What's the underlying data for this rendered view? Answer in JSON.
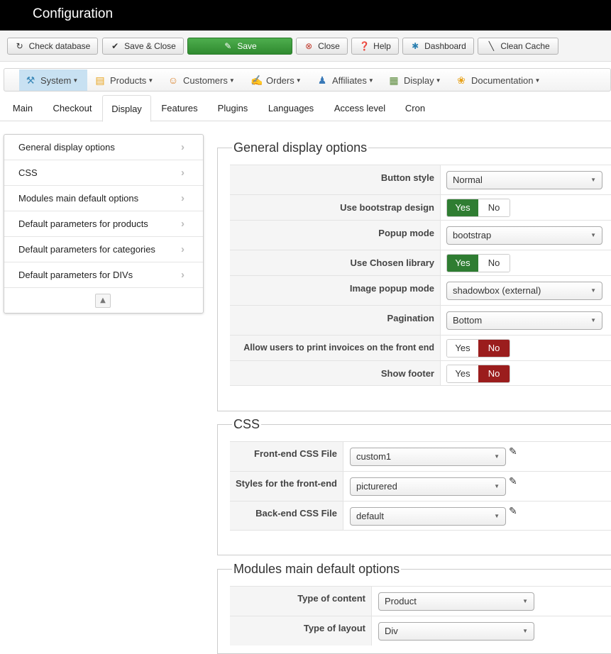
{
  "window": {
    "title": "Configuration"
  },
  "toolbar": {
    "check_database": "Check database",
    "save_close": "Save & Close",
    "save": "Save",
    "close": "Close",
    "help": "Help",
    "dashboard": "Dashboard",
    "clean_cache": "Clean Cache"
  },
  "menu": {
    "system": "System",
    "products": "Products",
    "customers": "Customers",
    "orders": "Orders",
    "affiliates": "Affiliates",
    "display": "Display",
    "documentation": "Documentation"
  },
  "tabs": {
    "main": "Main",
    "checkout": "Checkout",
    "display": "Display",
    "features": "Features",
    "plugins": "Plugins",
    "languages": "Languages",
    "access_level": "Access level",
    "cron": "Cron"
  },
  "sidenav": {
    "general": "General display options",
    "css": "CSS",
    "modules": "Modules main default options",
    "products": "Default parameters for products",
    "categories": "Default parameters for categories",
    "divs": "Default parameters for DIVs"
  },
  "general": {
    "title": "General display options",
    "button_style": {
      "label": "Button style",
      "value": "Normal"
    },
    "bootstrap": {
      "label": "Use bootstrap design",
      "yes": "Yes",
      "no": "No"
    },
    "popup_mode": {
      "label": "Popup mode",
      "value": "bootstrap"
    },
    "chosen": {
      "label": "Use Chosen library",
      "yes": "Yes",
      "no": "No"
    },
    "image_popup": {
      "label": "Image popup mode",
      "value": "shadowbox (external)"
    },
    "pagination": {
      "label": "Pagination",
      "value": "Bottom"
    },
    "print_invoices": {
      "label": "Allow users to print invoices on the front end",
      "yes": "Yes",
      "no": "No"
    },
    "show_footer": {
      "label": "Show footer",
      "yes": "Yes",
      "no": "No"
    }
  },
  "css": {
    "title": "CSS",
    "frontend_file": {
      "label": "Front-end CSS File",
      "value": "custom1"
    },
    "frontend_styles": {
      "label": "Styles for the front-end",
      "value": "picturered"
    },
    "backend_file": {
      "label": "Back-end CSS File",
      "value": "default"
    }
  },
  "modules": {
    "title": "Modules main default options",
    "content_type": {
      "label": "Type of content",
      "value": "Product"
    },
    "layout_type": {
      "label": "Type of layout",
      "value": "Div"
    }
  },
  "colors": {
    "yes_active": "#2f7d32",
    "no_active": "#9b1d1d",
    "save_button": "#3a9a3a",
    "active_menu": "#c8e1f2"
  }
}
